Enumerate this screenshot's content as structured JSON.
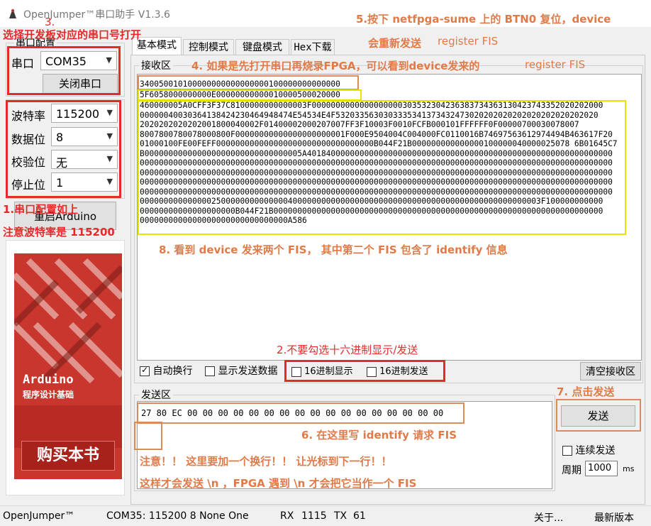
{
  "window": {
    "title": "OpenJumper™串口助手  V1.3.6"
  },
  "serial_config": {
    "group_title": "串口配置",
    "port_label": "串口",
    "port_value": "COM35",
    "close_button": "关闭串口",
    "baud_label": "波特率",
    "baud_value": "115200",
    "databits_label": "数据位",
    "databits_value": "8",
    "parity_label": "校验位",
    "parity_value": "无",
    "stopbits_label": "停止位",
    "stopbits_value": "1",
    "restart_button": "重启Arduino"
  },
  "tabs": [
    "基本模式",
    "控制模式",
    "键盘模式",
    "Hex下载"
  ],
  "receive": {
    "group_title": "接收区",
    "lines": [
      "340050010100000000000000000100000000000000",
      "5F6058000000000E00000000000010000500020000",
      "460000005A0CFF3F37C8100000000000003F0000000000000000000303532304236383734363130423743352020202000",
      "00000040030364138424230464948474E54534E4F5320335630303335341373432473020202020202020202020202020",
      "2020202020202001800040002F01400002000207007FF3F10003F0010FCFB000101FFFFFF0F00000700030078007",
      "8007800780078000800F00000000000000000000001F000E9504004C004000FC0110016B74697563612974494B463617F20",
      "01000100FE00FEFF000000000000000000000000000000000B044F21B000000000000000100000040000025078 6B01645C7",
      "B000000000000000000000000000000005A4018400000000000000000000000000000000000000000000000000000000000",
      "000000000000000000000000000000000000000000000000000000000000000000000000000000000000000000000000000",
      "000000000000000000000000000000000000000000000000000000000000000000000000000000000000000000000000000",
      "000000000000000000000000000000000000000000000000000000000000000000000000000000000000000000000000000",
      "000000000000000000000000000000000000000000000000000000000000000000000000000000000000000000000000000",
      "000000000000000250000000000000040000000000000000000000000000000000000000000000000003F100000000000",
      "00000000000000000000B044F21B000000000000000000000000000000000000000000000000000000000000000000000",
      "0000000000000000000000000000000A586"
    ],
    "auto_wrap_label": "自动换行",
    "show_sent_label": "显示发送数据",
    "hex_display_label": "16进制显示",
    "hex_send_label": "16进制发送",
    "clear_button": "清空接收区"
  },
  "send": {
    "group_title": "发送区",
    "content": "27 80 EC 00 00 00 00 00 00 00 00 00 00 00 00 00 00 00 00 00",
    "send_button": "发送",
    "continuous_label": "连续发送",
    "period_label": "周期",
    "period_value": "1000",
    "period_unit": "ms"
  },
  "status_bar": {
    "brand": "OpenJumper™",
    "port_info": "COM35: 115200 8 None One",
    "rx_label": "RX",
    "rx_value": "1115",
    "tx_label": "TX",
    "tx_value": "61",
    "about": "关于...",
    "latest": "最新版本"
  },
  "book": {
    "title_en": "Arduino",
    "title_cn": "程序设计基础",
    "buy_label": "购买本书"
  },
  "annotations": {
    "a3_num": "3.",
    "a3": "选择开发板对应的串口号打开",
    "a1_line1": "1.串口配置如上",
    "a1_line2": "注意波特率是 115200",
    "a4": "4. 如果是先打开串口再烧录FPGA，可以看到device发来的",
    "a4_tail": "register FIS",
    "a5_line1": "5.按下 netfpga-sume 上的 BTN0 复位，device",
    "a5_line2": "会重新发送",
    "a5_tail": "register FIS",
    "a8": "8. 看到 device 发来两个 FIS， 其中第二个 FIS 包含了 identify 信息",
    "a2": "2.不要勾选十六进制显示/发送",
    "a7": "7. 点击发送",
    "a6": "6. 在这里写 identify 请求 FIS",
    "note1": "注意！！ 这里要加一个换行！！ 让光标到下一行！！",
    "note2": "这样才会发送 \\n ，FPGA 遇到 \\n 才会把它当作一个 FIS"
  },
  "colors": {
    "annotation_red": "#e52a2a",
    "annotation_orange": "#e07a48",
    "highlight_yellow": "#e8e300"
  }
}
